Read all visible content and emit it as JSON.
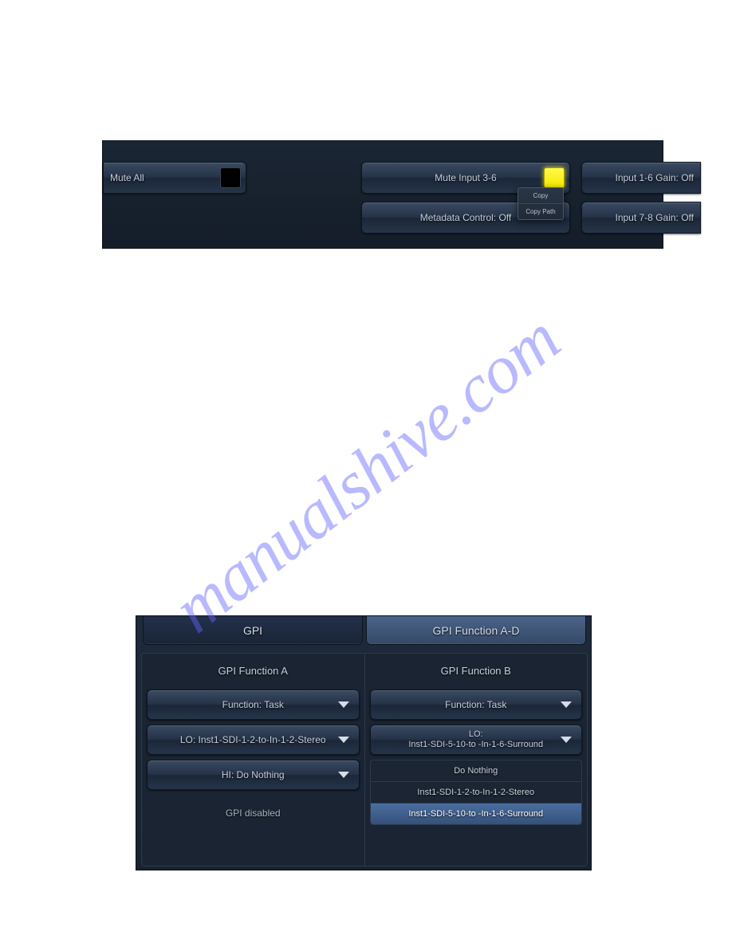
{
  "watermark": "manualshive.com",
  "panel1": {
    "mute_all_label": "Mute All",
    "mute_input_label": "Mute Input 3-6",
    "metadata_label": "Metadata Control: Off",
    "gain1_label": "Input 1-6 Gain: Off",
    "gain2_label": "Input 7-8 Gain: Off",
    "context": {
      "copy": "Copy",
      "copy_path": "Copy Path"
    }
  },
  "panel2": {
    "tab_gpi": "GPI",
    "tab_func": "GPI Function A-D",
    "colA": {
      "heading": "GPI Function A",
      "function_label": "Function: Task",
      "lo_label": "LO: Inst1-SDI-1-2-to-In-1-2-Stereo",
      "hi_label": "HI: Do Nothing",
      "disabled": "GPI disabled"
    },
    "colB": {
      "heading": "GPI Function B",
      "function_label": "Function: Task",
      "lo_line1": "LO:",
      "lo_line2": "Inst1-SDI-5-10-to -In-1-6-Surround",
      "options": {
        "do_nothing": "Do Nothing",
        "stereo": "Inst1-SDI-1-2-to-In-1-2-Stereo",
        "surround": "Inst1-SDI-5-10-to -In-1-6-Surround"
      }
    }
  }
}
